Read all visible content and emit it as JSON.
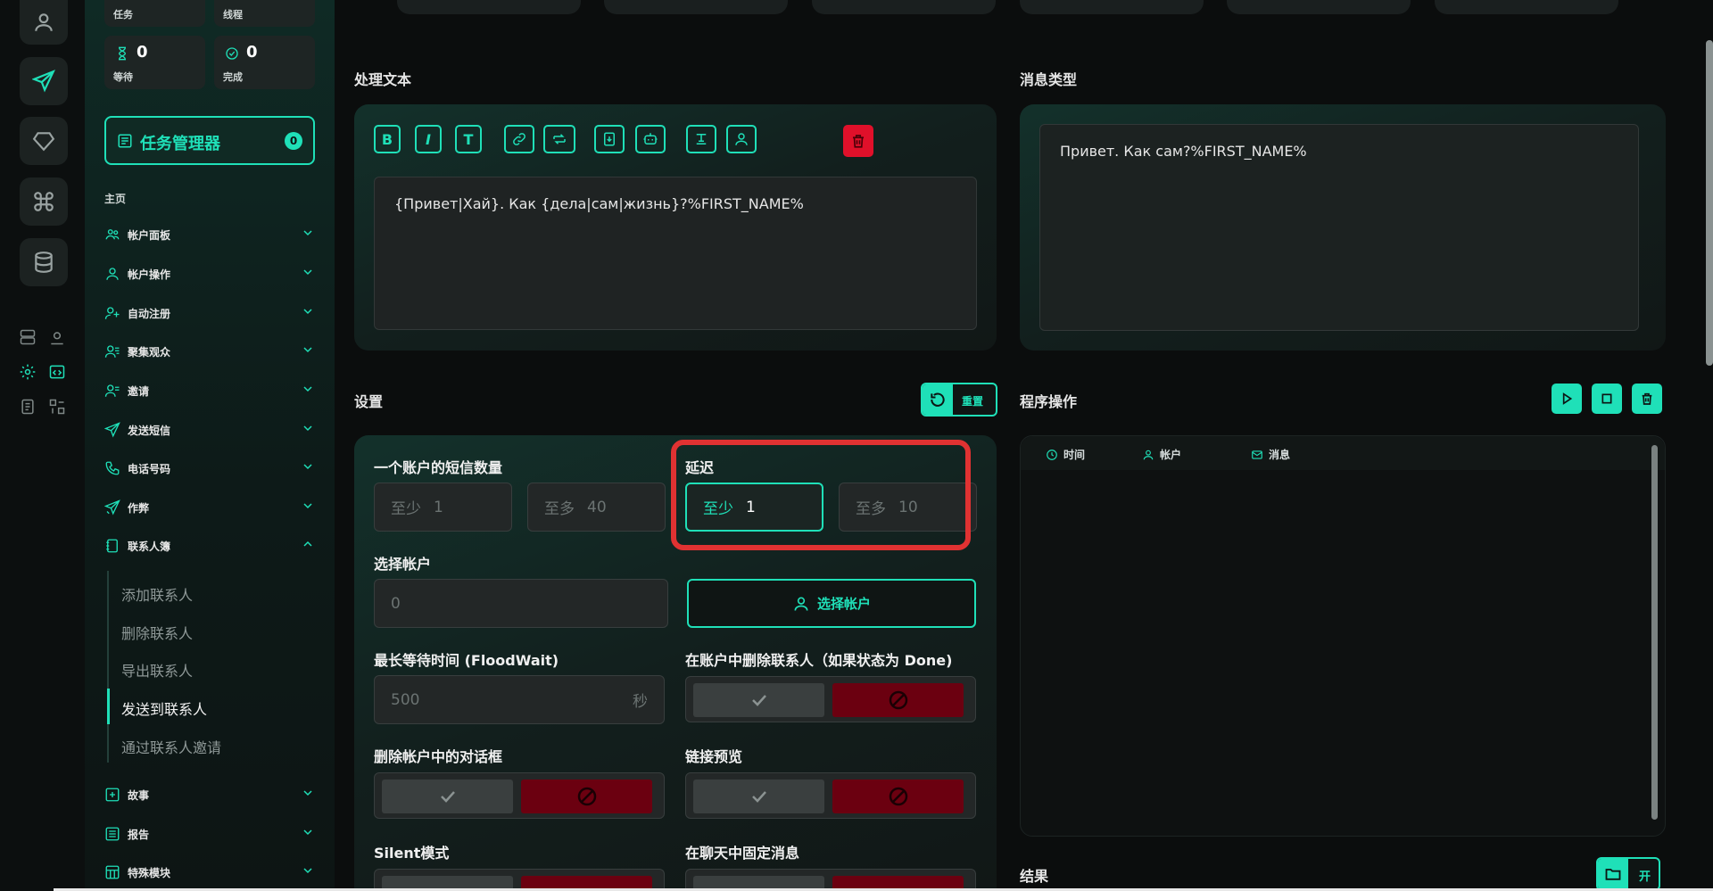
{
  "sidebar": {
    "stats_top": [
      "任务",
      "线程"
    ],
    "stats": [
      {
        "value": "0",
        "label": "等待",
        "icon": "hourglass-icon"
      },
      {
        "value": "0",
        "label": "完成",
        "icon": "check-circle-icon"
      }
    ],
    "task_manager": {
      "label": "任务管理器",
      "count": "0"
    },
    "section_title": "主页",
    "items": [
      {
        "label": "帐户面板",
        "icon": "users-icon"
      },
      {
        "label": "帐户操作",
        "icon": "user-icon"
      },
      {
        "label": "自动注册",
        "icon": "user-plus-icon"
      },
      {
        "label": "聚集观众",
        "icon": "user-group-icon"
      },
      {
        "label": "邀请",
        "icon": "user-invite-icon"
      },
      {
        "label": "发送短信",
        "icon": "send-icon"
      },
      {
        "label": "电话号码",
        "icon": "phone-icon"
      },
      {
        "label": "作弊",
        "icon": "send-cheat-icon"
      },
      {
        "label": "联系人簿",
        "icon": "book-icon"
      }
    ],
    "sub_items": [
      "添加联系人",
      "删除联系人",
      "导出联系人",
      "发送到联系人",
      "通过联系人邀请"
    ],
    "items_bottom": [
      {
        "label": "故事",
        "icon": "plus-square-icon"
      },
      {
        "label": "报告",
        "icon": "report-icon"
      },
      {
        "label": "特殊模块",
        "icon": "module-icon"
      }
    ]
  },
  "editor": {
    "title": "处理文本",
    "format_buttons": [
      "B",
      "I",
      "T"
    ],
    "text": "{Привет|Хай}. Как {дела|сам|жизнь}?%FIRST_NAME%"
  },
  "preview": {
    "title": "消息类型",
    "text": "Привет. Как сам?%FIRST_NAME%"
  },
  "settings": {
    "title": "设置",
    "reset_label": "重置",
    "sms_count_label": "一个账户的短信数量",
    "sms_min": {
      "prefix": "至少",
      "value": "1"
    },
    "sms_max": {
      "prefix": "至多",
      "value": "40"
    },
    "delay_label": "延迟",
    "delay_min": {
      "prefix": "至少",
      "value": "1"
    },
    "delay_max": {
      "prefix": "至多",
      "value": "10"
    },
    "select_account_label": "选择帐户",
    "select_account_value": "0",
    "select_account_button": "选择帐户",
    "floodwait_label": "最长等待时间 (FloodWait)",
    "floodwait_value": "500",
    "floodwait_unit": "秒",
    "delete_contacts_label": "在账户中删除联系人（如果状态为 Done)",
    "delete_dialogs_label": "删除帐户中的对话框",
    "link_preview_label": "链接预览",
    "silent_label": "Silent模式",
    "pin_label": "在聊天中固定消息"
  },
  "program": {
    "title": "程序操作",
    "columns": [
      {
        "label": "时间",
        "icon": "clock-icon"
      },
      {
        "label": "帐户",
        "icon": "user-icon"
      },
      {
        "label": "消息",
        "icon": "mail-icon"
      }
    ]
  },
  "results": {
    "title": "结果",
    "open_label": "开"
  },
  "colors": {
    "accent": "#1fe0b8",
    "danger": "#e0102a",
    "highlight": "#e03232"
  }
}
